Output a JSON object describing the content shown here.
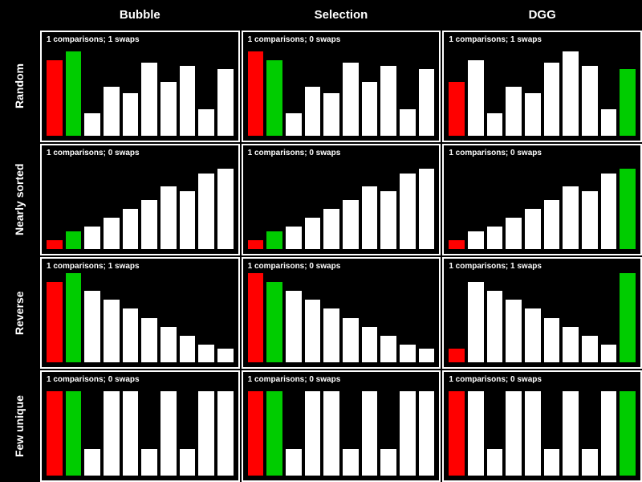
{
  "columns": [
    "Bubble",
    "Selection",
    "DGG"
  ],
  "rows": [
    "Random",
    "Nearly sorted",
    "Reverse",
    "Few unique"
  ],
  "chart_data": [
    [
      {
        "type": "bar",
        "status": "1 comparisons; 1 swaps",
        "values": [
          85,
          95,
          25,
          55,
          48,
          82,
          60,
          78,
          30,
          75
        ],
        "highlight": {
          "0": "red",
          "1": "green"
        }
      },
      {
        "type": "bar",
        "status": "1 comparisons; 0 swaps",
        "values": [
          95,
          85,
          25,
          55,
          48,
          82,
          60,
          78,
          30,
          75
        ],
        "highlight": {
          "0": "red",
          "1": "green"
        }
      },
      {
        "type": "bar",
        "status": "1 comparisons; 1 swaps",
        "values": [
          60,
          85,
          25,
          55,
          48,
          82,
          95,
          78,
          30,
          75
        ],
        "highlight": {
          "0": "red",
          "9": "green"
        }
      }
    ],
    [
      {
        "type": "bar",
        "status": "1 comparisons; 0 swaps",
        "values": [
          10,
          20,
          25,
          35,
          45,
          55,
          70,
          65,
          85,
          90
        ],
        "highlight": {
          "0": "red",
          "1": "green"
        }
      },
      {
        "type": "bar",
        "status": "1 comparisons; 0 swaps",
        "values": [
          10,
          20,
          25,
          35,
          45,
          55,
          70,
          65,
          85,
          90
        ],
        "highlight": {
          "0": "red",
          "1": "green"
        }
      },
      {
        "type": "bar",
        "status": "1 comparisons; 0 swaps",
        "values": [
          10,
          20,
          25,
          35,
          45,
          55,
          70,
          65,
          85,
          90
        ],
        "highlight": {
          "0": "red",
          "9": "green"
        }
      }
    ],
    [
      {
        "type": "bar",
        "status": "1 comparisons; 1 swaps",
        "values": [
          90,
          100,
          80,
          70,
          60,
          50,
          40,
          30,
          20,
          15
        ],
        "highlight": {
          "0": "red",
          "1": "green"
        }
      },
      {
        "type": "bar",
        "status": "1 comparisons; 0 swaps",
        "values": [
          100,
          90,
          80,
          70,
          60,
          50,
          40,
          30,
          20,
          15
        ],
        "highlight": {
          "0": "red",
          "1": "green"
        }
      },
      {
        "type": "bar",
        "status": "1 comparisons; 1 swaps",
        "values": [
          15,
          90,
          80,
          70,
          60,
          50,
          40,
          30,
          20,
          100
        ],
        "highlight": {
          "0": "red",
          "9": "green"
        }
      }
    ],
    [
      {
        "type": "bar",
        "status": "1 comparisons; 0 swaps",
        "values": [
          95,
          95,
          30,
          95,
          95,
          30,
          95,
          30,
          95,
          95
        ],
        "highlight": {
          "0": "red",
          "1": "green"
        }
      },
      {
        "type": "bar",
        "status": "1 comparisons; 0 swaps",
        "values": [
          95,
          95,
          30,
          95,
          95,
          30,
          95,
          30,
          95,
          95
        ],
        "highlight": {
          "0": "red",
          "1": "green"
        }
      },
      {
        "type": "bar",
        "status": "1 comparisons; 0 swaps",
        "values": [
          95,
          95,
          30,
          95,
          95,
          30,
          95,
          30,
          95,
          95
        ],
        "highlight": {
          "0": "red",
          "9": "green"
        }
      }
    ]
  ]
}
